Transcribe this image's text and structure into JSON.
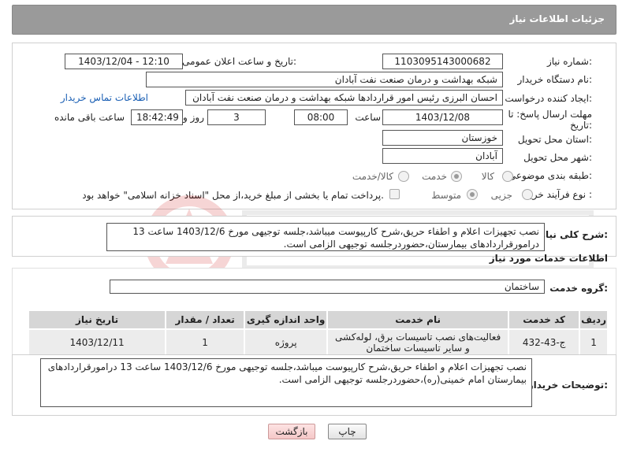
{
  "header": {
    "title": "جزئیات اطلاعات نیاز"
  },
  "fields": {
    "need_number_label": "شماره نیاز:",
    "need_number": "1103095143000682",
    "announce_datetime_label": "تاریخ و ساعت اعلان عمومی:",
    "announce_datetime": "1403/12/04 - 12:10",
    "buyer_org_label": "نام دستگاه خریدار:",
    "buyer_org": "شبکه بهداشت و درمان صنعت نفت آبادان",
    "creator_label": "ایجاد کننده درخواست:",
    "creator": "احسان البرزی رئیس امور قراردادها شبکه بهداشت و درمان صنعت نفت آبادان",
    "contact_link": "اطلاعات تماس خریدار",
    "deadline_label_1": "مهلت ارسال پاسخ: تا",
    "deadline_label_2": "تاریخ:",
    "deadline_date": "1403/12/08",
    "time_label": "ساعت",
    "deadline_time": "08:00",
    "days_count": "3",
    "days_label": "روز و",
    "remaining_time": "18:42:49",
    "remaining_label": "ساعت باقی مانده",
    "province_label": "استان محل تحویل:",
    "province": "خوزستان",
    "city_label": "شهر محل تحویل:",
    "city": "آبادان",
    "category_label": "طبقه بندی موضوعی:",
    "category_options": [
      "کالا",
      "خدمت",
      "کالا/خدمت"
    ],
    "category_selected": "خدمت",
    "process_label": "نوع فرآیند خرید :",
    "process_options": [
      "جزیی",
      "متوسط"
    ],
    "process_selected": "متوسط",
    "payment_note": "پرداخت تمام یا بخشی از مبلغ خرید،از محل \"اسناد خزانه اسلامی\" خواهد بود."
  },
  "description": {
    "label": "شرح کلی نیاز:",
    "text": "نصب تجهیزات اعلام و اطفاء حریق،شرح کارپیوست میباشد،جلسه توجیهی مورخ 1403/12/6 ساعت 13 درامورقراردادهای بیمارستان،حضوردرجلسه توجیهی الزامی است."
  },
  "services": {
    "section_title": "اطلاعات خدمات مورد نیاز",
    "group_label": "گروه خدمت:",
    "group_value": "ساختمان",
    "columns": [
      "ردیف",
      "کد خدمت",
      "نام خدمت",
      "واحد اندازه گیری",
      "تعداد / مقدار",
      "تاریخ نیاز"
    ],
    "rows": [
      [
        "1",
        "ج-43-432",
        "فعالیت‌های نصب تاسیسات برق، لوله‌کشی و سایر تاسیسات ساختمان",
        "پروژه",
        "1",
        "1403/12/11"
      ]
    ]
  },
  "buyer_notes": {
    "label": "توضیحات خریدار:",
    "text": "نصب تجهیزات اعلام و اطفاء حریق،شرح کارپیوست میباشد،جلسه توجیهی مورخ 1403/12/6 ساعت 13 درامورقراردادهای بیمارستان امام خمینی(ره)،حضوردرجلسه توجیهی الزامی است."
  },
  "buttons": {
    "print": "چاپ",
    "back": "بازگشت"
  },
  "colors": {
    "header_bg": "#9a9a9a",
    "link": "#1a5fb4",
    "table_header": "#d6d6d6",
    "table_row": "#ececec"
  }
}
